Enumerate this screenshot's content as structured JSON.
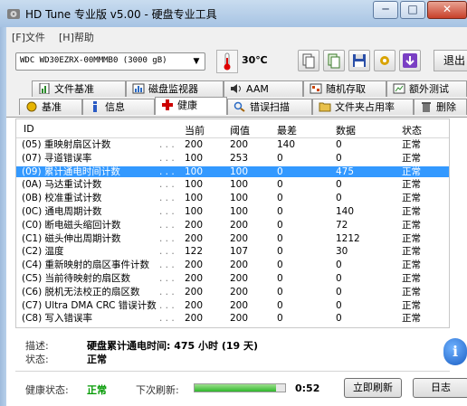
{
  "window": {
    "title": "HD Tune 专业版 v5.00 - 硬盘专业工具",
    "minimize": "─",
    "maximize": "□",
    "close": "✕"
  },
  "menu": [
    {
      "label": "[F]文件"
    },
    {
      "label": "[H]帮助"
    }
  ],
  "toolbar": {
    "drive": "WDC WD30EZRX-00MMMB0 (3000 gB)",
    "temperature": "30℃",
    "exit_label": "退出"
  },
  "tabs_row1": [
    {
      "label": "文件基准",
      "icon": "file-benchmark-icon"
    },
    {
      "label": "磁盘监视器",
      "icon": "disk-monitor-icon"
    },
    {
      "label": "AAM",
      "icon": "speaker-icon"
    },
    {
      "label": "随机存取",
      "icon": "random-access-icon"
    },
    {
      "label": "额外测试",
      "icon": "extra-tests-icon"
    }
  ],
  "tabs_row2": [
    {
      "label": "基准",
      "icon": "benchmark-icon"
    },
    {
      "label": "信息",
      "icon": "info-icon"
    },
    {
      "label": "健康",
      "icon": "health-cross-icon"
    },
    {
      "label": "错误扫描",
      "icon": "magnifier-icon"
    },
    {
      "label": "文件夹占用率",
      "icon": "folder-icon"
    },
    {
      "label": "删除",
      "icon": "trash-icon"
    }
  ],
  "table": {
    "headers": [
      "ID",
      "当前",
      "阈值",
      "最差",
      "数据",
      "状态"
    ],
    "rows": [
      {
        "id": "(05) 重映射扇区计数",
        "current": "200",
        "threshold": "200",
        "worst": "140",
        "data": "0",
        "status": "正常"
      },
      {
        "id": "(07) 寻道错误率",
        "current": "100",
        "threshold": "253",
        "worst": "0",
        "data": "0",
        "status": "正常"
      },
      {
        "id": "(09) 累计通电时间计数",
        "current": "100",
        "threshold": "100",
        "worst": "0",
        "data": "475",
        "status": "正常"
      },
      {
        "id": "(0A) 马达重试计数",
        "current": "100",
        "threshold": "100",
        "worst": "0",
        "data": "0",
        "status": "正常"
      },
      {
        "id": "(0B) 校准重试计数",
        "current": "100",
        "threshold": "100",
        "worst": "0",
        "data": "0",
        "status": "正常"
      },
      {
        "id": "(0C) 通电周期计数",
        "current": "100",
        "threshold": "100",
        "worst": "0",
        "data": "140",
        "status": "正常"
      },
      {
        "id": "(C0) 断电磁头缩回计数",
        "current": "200",
        "threshold": "200",
        "worst": "0",
        "data": "72",
        "status": "正常"
      },
      {
        "id": "(C1) 磁头伸出周期计数",
        "current": "200",
        "threshold": "200",
        "worst": "0",
        "data": "1212",
        "status": "正常"
      },
      {
        "id": "(C2) 温度",
        "current": "122",
        "threshold": "107",
        "worst": "0",
        "data": "30",
        "status": "正常"
      },
      {
        "id": "(C4) 重新映射的扇区事件计数",
        "current": "200",
        "threshold": "200",
        "worst": "0",
        "data": "0",
        "status": "正常"
      },
      {
        "id": "(C5) 当前待映射的扇区数",
        "current": "200",
        "threshold": "200",
        "worst": "0",
        "data": "0",
        "status": "正常"
      },
      {
        "id": "(C6) 脱机无法校正的扇区数",
        "current": "200",
        "threshold": "200",
        "worst": "0",
        "data": "0",
        "status": "正常"
      },
      {
        "id": "(C7) Ultra DMA CRC 错误计数",
        "current": "200",
        "threshold": "200",
        "worst": "0",
        "data": "0",
        "status": "正常"
      },
      {
        "id": "(C8) 写入错误率",
        "current": "200",
        "threshold": "200",
        "worst": "0",
        "data": "0",
        "status": "正常"
      }
    ],
    "selected_index": 2,
    "dots": ". . ."
  },
  "details": {
    "desc_label": "描述:",
    "desc_value": "硬盘累计通电时间: 475 小时 (19 天)",
    "status_label": "状态:",
    "status_value": "正常"
  },
  "footer": {
    "health_label": "健康状态:",
    "health_value": "正常",
    "next_refresh_label": "下次刷新:",
    "countdown": "0:52",
    "progress_fraction": 0.9,
    "refresh_button": "立即刷新",
    "log_button": "日志"
  },
  "colors": {
    "selection": "#3399ff",
    "health_ok": "#009900",
    "accent_red": "#cc0000"
  }
}
